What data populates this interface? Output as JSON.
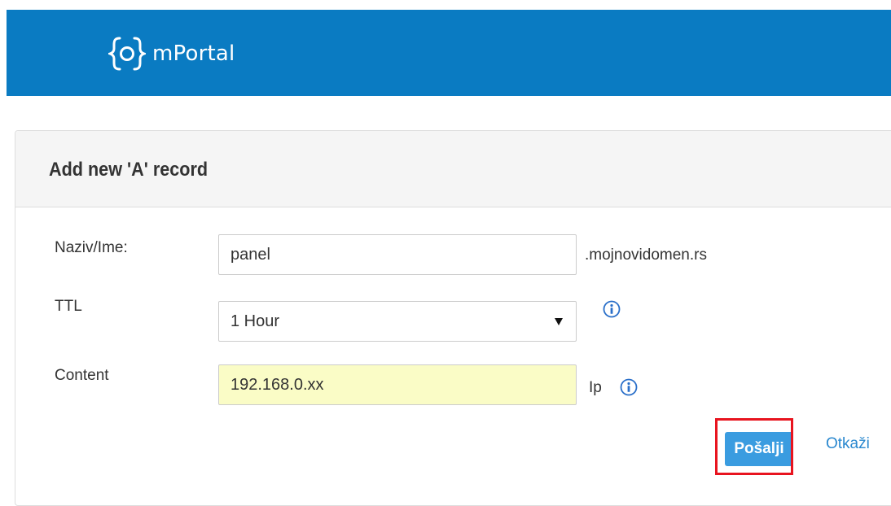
{
  "app": {
    "name": "mPortal",
    "logo_icon": "gear-cog-icon"
  },
  "panel": {
    "title": "Add new 'A' record"
  },
  "form": {
    "name": {
      "label": "Naziv/Ime:",
      "value": "panel",
      "suffix": ".mojnovidomen.rs"
    },
    "ttl": {
      "label": "TTL",
      "selected": "1 Hour",
      "info_icon": "info-icon"
    },
    "content": {
      "label": "Content",
      "value": "192.168.0.xx",
      "suffix": "Ip",
      "info_icon": "info-icon"
    }
  },
  "actions": {
    "submit_label": "Pošalji",
    "cancel_label": "Otkaži"
  },
  "colors": {
    "header": "#0a7bc2",
    "submit_button": "#3a9ce0",
    "content_field_bg": "#fafcc6",
    "highlight_box": "#e8141f",
    "link": "#2a88cf"
  }
}
